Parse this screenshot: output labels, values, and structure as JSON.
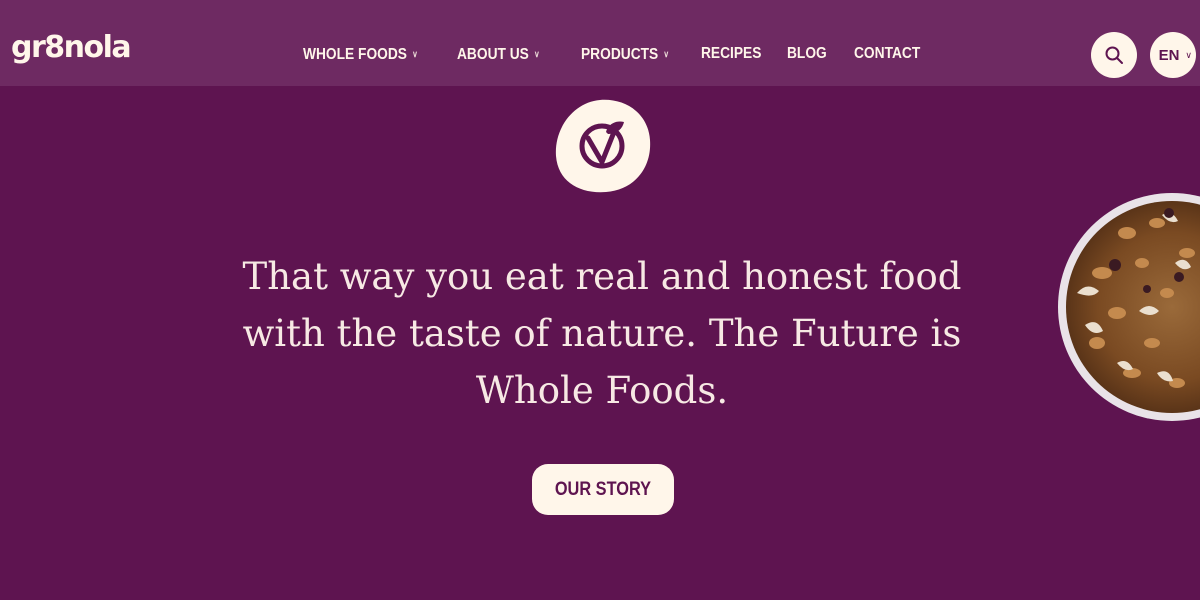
{
  "header": {
    "logo": "gr8nola",
    "nav": [
      {
        "label": "WHOLE FOODS",
        "has_dropdown": true
      },
      {
        "label": "ABOUT US",
        "has_dropdown": true
      },
      {
        "label": "PRODUCTS",
        "has_dropdown": true
      },
      {
        "label": "RECIPES",
        "has_dropdown": false
      },
      {
        "label": "BLOG",
        "has_dropdown": false
      },
      {
        "label": "CONTACT",
        "has_dropdown": false
      }
    ],
    "language": "EN",
    "search_icon": "search-icon"
  },
  "hero": {
    "badge_icon": "vegan-leaf-icon",
    "headline": "That way you eat real and honest food with the taste of nature. The Future is Whole Foods.",
    "cta_label": "OUR STORY"
  },
  "colors": {
    "background": "#5e1450",
    "header": "#6e2a62",
    "cream": "#fff6ea",
    "headline": "#f7e9e4"
  }
}
